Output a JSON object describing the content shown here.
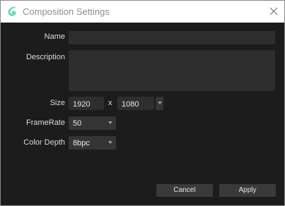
{
  "window": {
    "title": "Composition Settings",
    "icon": "app-logo-icon",
    "close_icon": "close-icon"
  },
  "form": {
    "name": {
      "label": "Name",
      "value": ""
    },
    "description": {
      "label": "Description",
      "value": ""
    },
    "size": {
      "label": "Size",
      "width": "1920",
      "separator": "x",
      "height": "1080"
    },
    "framerate": {
      "label": "FrameRate",
      "value": "50"
    },
    "color_depth": {
      "label": "Color Depth",
      "value": "8bpc"
    }
  },
  "buttons": {
    "cancel": "Cancel",
    "apply": "Apply"
  },
  "colors": {
    "accent": "#5fd4a8",
    "background": "#1c1c1c",
    "field": "#2e2e2e"
  }
}
